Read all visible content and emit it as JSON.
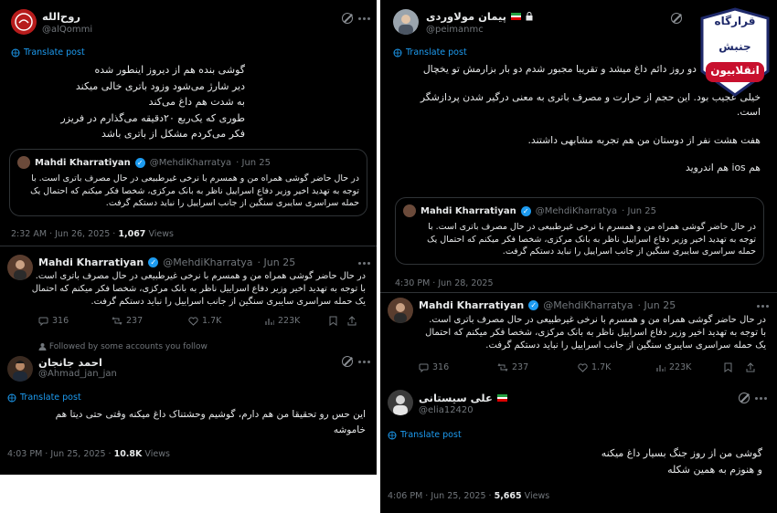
{
  "left": {
    "tweet1": {
      "name": "روح‌الله",
      "handle": "@alQommi",
      "translate": "Translate post",
      "lines": [
        "گوشی بنده هم از دیروز اینطور شده",
        "دیر شارژ می‌شود وزود باتری خالی میکند",
        "به شدت هم داغ می‌کند",
        "طوری که یک‌ربع ۲۰دقیقه می‌گذارم در فریزر",
        "فکر می‌کردم مشکل از باتری باشد"
      ],
      "quote": {
        "name": "Mahdi Kharratiyan",
        "handle": "@MehdiKharratya",
        "date": "· Jun 25",
        "lines": [
          "در حال حاضر گوشی همراه من و همسرم با نرخی غیرطبیعی در حال مصرف باتری است. با",
          "توجه به تهدید اخیر وزیر دفاع اسراییل ناظر به بانک مرکزی، شخصا فکر میکنم که احتمال یک",
          "حمله سراسری سایبری سنگین از جانب اسراییل را نباید دستکم گرفت."
        ]
      },
      "time": "2:32 AM · Jun 26, 2025 ·",
      "views_count": "1,067",
      "views_label": "Views"
    },
    "tweet2": {
      "name": "Mahdi Kharratiyan",
      "handle": "@MehdiKharratya",
      "date": "· Jun 25",
      "lines": [
        "در حال حاضر گوشی همراه من و همسرم با نرخی غیرطبیعی در حال مصرف باتری است.",
        "با توجه به تهدید اخیر وزیر دفاع اسراییل ناظر به بانک مرکزی، شخصا فکر میکنم که احتمال",
        "یک حمله سراسری سایبری سنگین از جانب اسراییل را نباید دستکم گرفت."
      ],
      "stats": {
        "replies": "316",
        "reposts": "237",
        "likes": "1.7K",
        "views": "223K"
      }
    },
    "tweet3": {
      "followed": "Followed by some accounts you follow",
      "name": "احمد جانجان",
      "handle": "@Ahmad_jan_jan",
      "translate": "Translate post",
      "lines": [
        "این حس رو تحقیقا من هم دارم، گوشیم وحشتناک داغ میکنه وقتی حتی دیتا هم",
        "خاموشه"
      ],
      "time": "4:03 PM · Jun 25, 2025 ·",
      "views_count": "10.8K",
      "views_label": "Views"
    }
  },
  "right": {
    "tweet1": {
      "name": "پیمان مولاوردی",
      "handle": "@peimanmc",
      "translate": "Translate post",
      "lines": [
        "دو روز دائم داغ میشد و تقریبا مجبور شدم دو بار بزارمش تو یخچال",
        "",
        "خیلی عجیب بود. این حجم از حرارت و مصرف باتری به معنی درگیر شدن پردازشگر",
        "است.",
        "",
        "هفت هشت نفر از دوستان من هم تجربه مشابهی داشتند.",
        "",
        "هم ios هم اندروید"
      ],
      "quote": {
        "name": "Mahdi Kharratiyan",
        "handle": "@MehdiKharratya",
        "date": "· Jun 25",
        "lines": [
          "در حال حاضر گوشی همراه من و همسرم با نرخی غیرطبیعی در حال مصرف باتری است. با",
          "توجه به تهدید اخیر وزیر دفاع اسراییل ناظر به بانک مرکزی، شخصا فکر میکنم که احتمال یک",
          "حمله سراسری سایبری سنگین از جانب اسراییل را نباید دستکم گرفت."
        ]
      },
      "time": "4:30 PM · Jun 28, 2025"
    },
    "tweet2": {
      "name": "Mahdi Kharratiyan",
      "handle": "@MehdiKharratya",
      "date": "· Jun 25",
      "lines": [
        "در حال حاضر گوشی همراه من و همسرم با نرخی غیرطبیعی در حال مصرف باتری است.",
        "با توجه به تهدید اخیر وزیر دفاع اسراییل ناظر به بانک مرکزی، شخصا فکر میکنم که احتمال",
        "یک حمله سراسری سایبری سنگین از جانب اسراییل را نباید دستکم گرفت."
      ],
      "stats": {
        "replies": "316",
        "reposts": "237",
        "likes": "1.7K",
        "views": "223K"
      }
    },
    "tweet3": {
      "name": "علی سیستانی",
      "handle": "@elia12420",
      "translate": "Translate post",
      "lines": [
        "گوشی من از روز جنگ بسیار داغ میکنه",
        "و هنوزم به همین شکله"
      ],
      "time": "4:06 PM · Jun 25, 2025 ·",
      "views_count": "5,665",
      "views_label": "Views"
    }
  },
  "logo": {
    "line1": "قرارگاه",
    "line2": "جنبش",
    "line3": "انقلابیون"
  },
  "colors": {
    "background": "#000000",
    "accent": "#1d9bf0",
    "muted": "#71767b",
    "text": "#e7e9ea",
    "border": "#2f3336",
    "logo_red": "#c8102e",
    "logo_navy": "#1f2a6b"
  }
}
